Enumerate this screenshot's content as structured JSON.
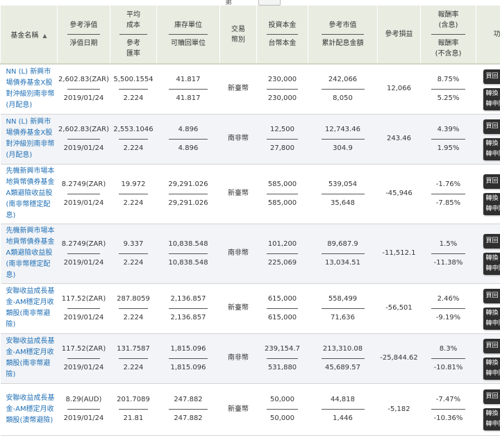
{
  "header": {
    "fund_name": "基金名稱",
    "nav": [
      "參考淨值",
      "淨值日期"
    ],
    "avg_cost": [
      "平均",
      "成本",
      "參考",
      "匯率"
    ],
    "units": [
      "庫存單位",
      "可贖回單位"
    ],
    "currency": [
      "交易",
      "幣別"
    ],
    "principal": [
      "投資本金",
      "台幣本金"
    ],
    "market_value": [
      "參考市值",
      "累計配息金額"
    ],
    "pnl": "參考損益",
    "return": [
      "報酬率",
      "(含息)",
      "報酬率",
      "(不含息)"
    ],
    "actions": "功能"
  },
  "pagination_label": "第",
  "actions": {
    "buy": "買回",
    "switch": "轉換",
    "apply": "轉申購"
  },
  "rows": [
    {
      "name": "NN (L) 新興市場債券基金X股對沖級別南非幣(月配息)",
      "nav": "2,602.83(ZAR)",
      "nav_date": "2019/01/24",
      "avg_cost": "5,500.1554",
      "fx": "2.224",
      "units": "41.817",
      "redeemable": "41.817",
      "currency": "新臺幣",
      "principal": "230,000",
      "twd_principal": "230,000",
      "market_value": "242,066",
      "dividend": "8,050",
      "pnl": "12,066",
      "ret_incl": "8.75%",
      "ret_excl": "5.25%"
    },
    {
      "name": "NN (L) 新興市場債券基金X股對沖級別南非幣(月配息)",
      "nav": "2,602.83(ZAR)",
      "nav_date": "2019/01/24",
      "avg_cost": "2,553.1046",
      "fx": "2.224",
      "units": "4.896",
      "redeemable": "4.896",
      "currency": "南非幣",
      "principal": "12,500",
      "twd_principal": "27,800",
      "market_value": "12,743.46",
      "dividend": "304.9",
      "pnl": "243.46",
      "ret_incl": "4.39%",
      "ret_excl": "1.95%"
    },
    {
      "name": "先機新興市場本地貨幣債券基金A類避險收益股(南非幣穩定配息)",
      "nav": "8.2749(ZAR)",
      "nav_date": "2019/01/24",
      "avg_cost": "19.972",
      "fx": "2.224",
      "units": "29,291.026",
      "redeemable": "29,291.026",
      "currency": "新臺幣",
      "principal": "585,000",
      "twd_principal": "585,000",
      "market_value": "539,054",
      "dividend": "35,648",
      "pnl": "-45,946",
      "ret_incl": "-1.76%",
      "ret_excl": "-7.85%"
    },
    {
      "name": "先機新興市場本地貨幣債券基金A類避險收益股(南非幣穩定配息)",
      "nav": "8.2749(ZAR)",
      "nav_date": "2019/01/24",
      "avg_cost": "9.337",
      "fx": "2.224",
      "units": "10,838.548",
      "redeemable": "10,838.548",
      "currency": "南非幣",
      "principal": "101,200",
      "twd_principal": "225,069",
      "market_value": "89,687.9",
      "dividend": "13,034.51",
      "pnl": "-11,512.1",
      "ret_incl": "1.5%",
      "ret_excl": "-11.38%"
    },
    {
      "name": "安聯收益成長基金-AM穩定月收類股(南非幣避險)",
      "nav": "117.52(ZAR)",
      "nav_date": "2019/01/24",
      "avg_cost": "287.8059",
      "fx": "2.224",
      "units": "2,136.857",
      "redeemable": "2,136.857",
      "currency": "新臺幣",
      "principal": "615,000",
      "twd_principal": "615,000",
      "market_value": "558,499",
      "dividend": "71,636",
      "pnl": "-56,501",
      "ret_incl": "2.46%",
      "ret_excl": "-9.19%"
    },
    {
      "name": "安聯收益成長基金-AM穩定月收類股(南非幣避險)",
      "nav": "117.52(ZAR)",
      "nav_date": "2019/01/24",
      "avg_cost": "131.7587",
      "fx": "2.224",
      "units": "1,815.096",
      "redeemable": "1,815.096",
      "currency": "南非幣",
      "principal": "239,154.7",
      "twd_principal": "531,880",
      "market_value": "213,310.08",
      "dividend": "45,689.57",
      "pnl": "-25,844.62",
      "ret_incl": "8.3%",
      "ret_excl": "-10.81%"
    },
    {
      "name": "安聯收益成長基金-AM穩定月收類股(澳幣避險)",
      "nav": "8.29(AUD)",
      "nav_date": "2019/01/24",
      "avg_cost": "201.7089",
      "fx": "21.81",
      "units": "247.882",
      "redeemable": "247.882",
      "currency": "新臺幣",
      "principal": "50,000",
      "twd_principal": "50,000",
      "market_value": "44,818",
      "dividend": "1,446",
      "pnl": "-5,182",
      "ret_incl": "-7.47%",
      "ret_excl": "-10.36%"
    }
  ]
}
